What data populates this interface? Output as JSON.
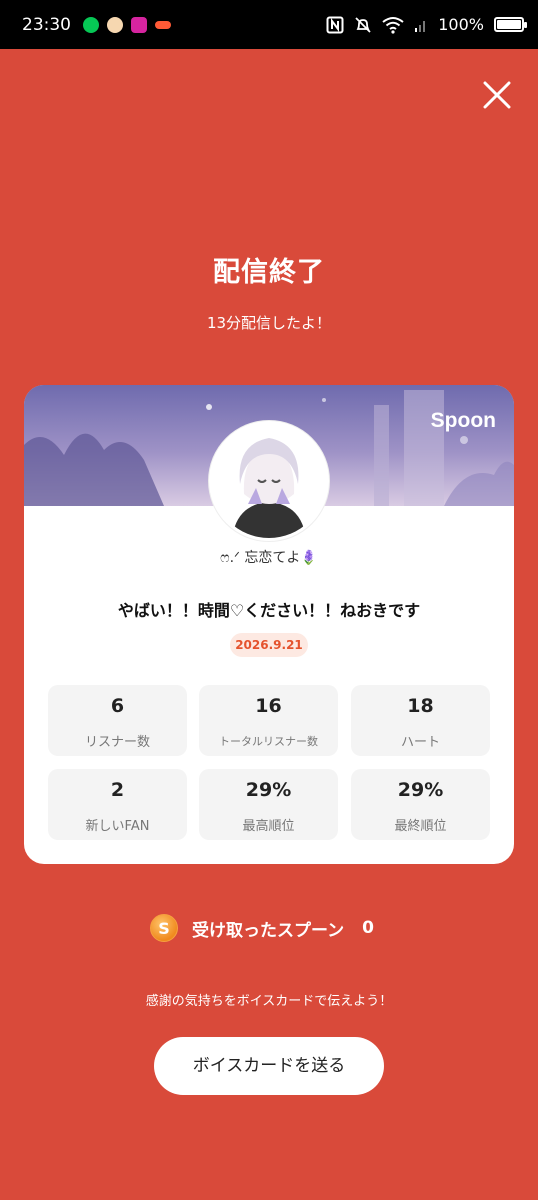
{
  "status_bar": {
    "time": "23:30",
    "battery": "100%",
    "apps": [
      {
        "icon": "line-icon",
        "color": "#06C755"
      },
      {
        "icon": "avatar-app-icon",
        "color": "#F6D7B0"
      },
      {
        "icon": "instagram-icon",
        "color": "#D6249F"
      },
      {
        "icon": "spoon-app-icon",
        "color": "#FF5A36"
      }
    ]
  },
  "close": {
    "icon": "close-icon"
  },
  "header": {
    "title": "配信終了",
    "subtitle": "13分配信したよ！"
  },
  "card": {
    "brand": "Spoon",
    "username": "ෆ.ᐟ 忘恋てよ🪻",
    "live_title": "やばい！！時間♡ください！！ねおきです",
    "date": "2026.9.21",
    "stats": [
      {
        "value": "6",
        "label": "リスナー数"
      },
      {
        "value": "16",
        "label": "トータルリスナー数"
      },
      {
        "value": "18",
        "label": "ハート"
      },
      {
        "value": "2",
        "label": "新しいFAN"
      },
      {
        "value": "29%",
        "label": "最高順位"
      },
      {
        "value": "29%",
        "label": "最終順位"
      }
    ]
  },
  "received": {
    "coin_letter": "S",
    "label": "受け取ったスプーン",
    "count": "0"
  },
  "thanks_text": "感謝の気持ちをボイスカードで伝えよう！",
  "voice_button": "ボイスカードを送る",
  "colors": {
    "background": "#D94A3A",
    "accent": "#E5532E",
    "card": "#FFFFFF"
  }
}
